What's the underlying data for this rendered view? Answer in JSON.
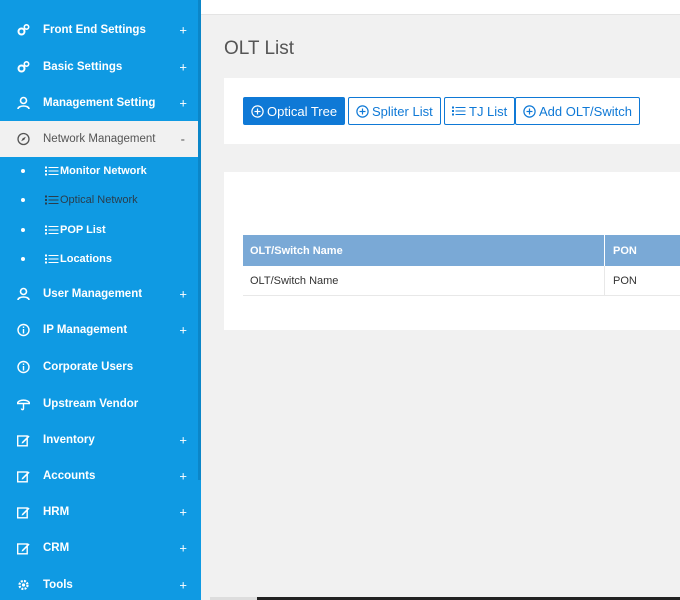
{
  "sidebar": {
    "items": [
      {
        "label": "Front End Settings",
        "icon": "gears-icon",
        "expander": "+"
      },
      {
        "label": "Basic Settings",
        "icon": "gears-icon",
        "expander": "+"
      },
      {
        "label": "Management Setting",
        "icon": "user-icon",
        "expander": "+"
      },
      {
        "label": "Network Management",
        "icon": "compass-icon",
        "expander": "-"
      },
      {
        "label": "User Management",
        "icon": "user-icon",
        "expander": "+"
      },
      {
        "label": "IP Management",
        "icon": "info-icon",
        "expander": "+"
      },
      {
        "label": "Corporate Users",
        "icon": "info-icon"
      },
      {
        "label": "Upstream Vendor",
        "icon": "umbrella-icon"
      },
      {
        "label": "Inventory",
        "icon": "edit-icon",
        "expander": "+"
      },
      {
        "label": "Accounts",
        "icon": "edit-icon",
        "expander": "+"
      },
      {
        "label": "HRM",
        "icon": "edit-icon",
        "expander": "+"
      },
      {
        "label": "CRM",
        "icon": "edit-icon",
        "expander": "+"
      },
      {
        "label": "Tools",
        "icon": "gear-icon",
        "expander": "+"
      }
    ],
    "subitems": [
      {
        "label": "Monitor Network",
        "icon": "list-icon"
      },
      {
        "label": "Optical Network",
        "icon": "list-icon"
      },
      {
        "label": "POP List",
        "icon": "list-icon"
      },
      {
        "label": "Locations",
        "icon": "list-icon"
      }
    ],
    "active_item": "Network Management",
    "current_subitem": "Optical Network",
    "colors": {
      "background": "#0f9ae3",
      "active_background": "#f1f1f1"
    }
  },
  "main": {
    "title": "OLT List",
    "buttons": [
      {
        "label": "Optical Tree",
        "icon": "plus-circle-icon",
        "primary": true
      },
      {
        "label": "Spliter List",
        "icon": "plus-circle-icon"
      },
      {
        "label": "TJ List",
        "icon": "list-icon"
      },
      {
        "label": "Add OLT/Switch",
        "icon": "plus-circle-icon"
      }
    ],
    "table": {
      "columns": [
        "OLT/Switch Name",
        "PON"
      ],
      "rows": [
        [
          "OLT/Switch Name",
          "PON"
        ]
      ]
    },
    "colors": {
      "primary": "#0f79d6",
      "table_header": "#7aa9d6"
    }
  }
}
